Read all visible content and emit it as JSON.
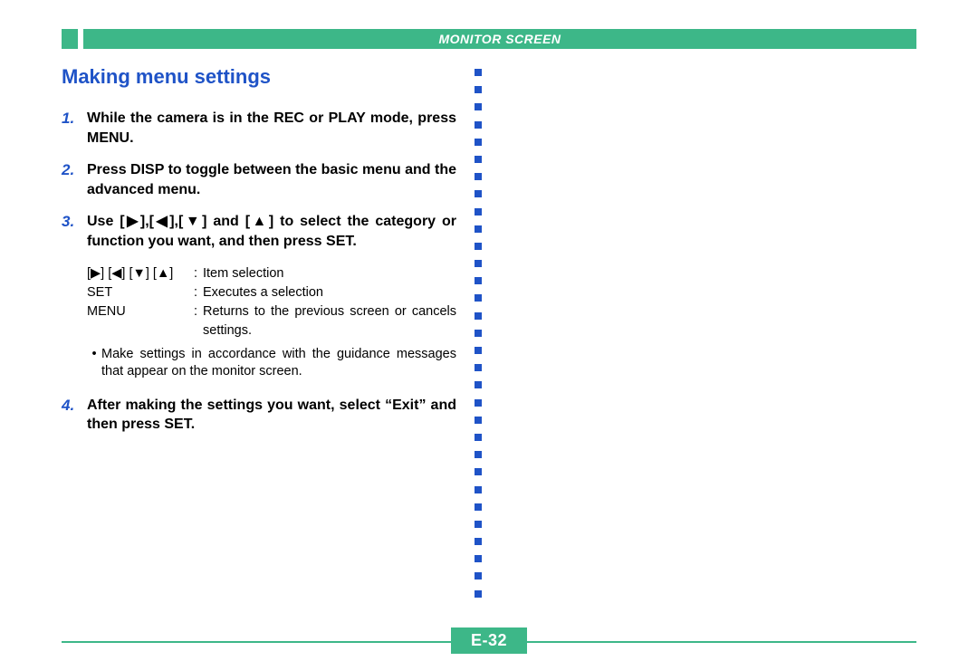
{
  "header": {
    "title": "MONITOR SCREEN"
  },
  "section_title": "Making menu settings",
  "steps": {
    "s1": {
      "num": "1.",
      "text": "While the camera is in the REC or PLAY mode, press MENU."
    },
    "s2": {
      "num": "2.",
      "text": "Press DISP to toggle between the basic menu and the advanced menu."
    },
    "s3": {
      "num": "3.",
      "text": "Use [▶],[◀],[▼] and [▲] to select the category or function you want, and then press SET."
    },
    "s4": {
      "num": "4.",
      "text": "After making the settings you want, select “Exit” and then press SET."
    }
  },
  "defs": {
    "d1": {
      "key": "[▶] [◀] [▼] [▲]",
      "val": "Item selection"
    },
    "d2": {
      "key": "SET",
      "val": "Executes a selection"
    },
    "d3": {
      "key": "MENU",
      "val": "Returns to the previous screen or cancels settings."
    }
  },
  "bullet": {
    "text": "Make settings in accordance with the guidance messages that appear on the monitor screen."
  },
  "footer": {
    "label": "E-32"
  }
}
